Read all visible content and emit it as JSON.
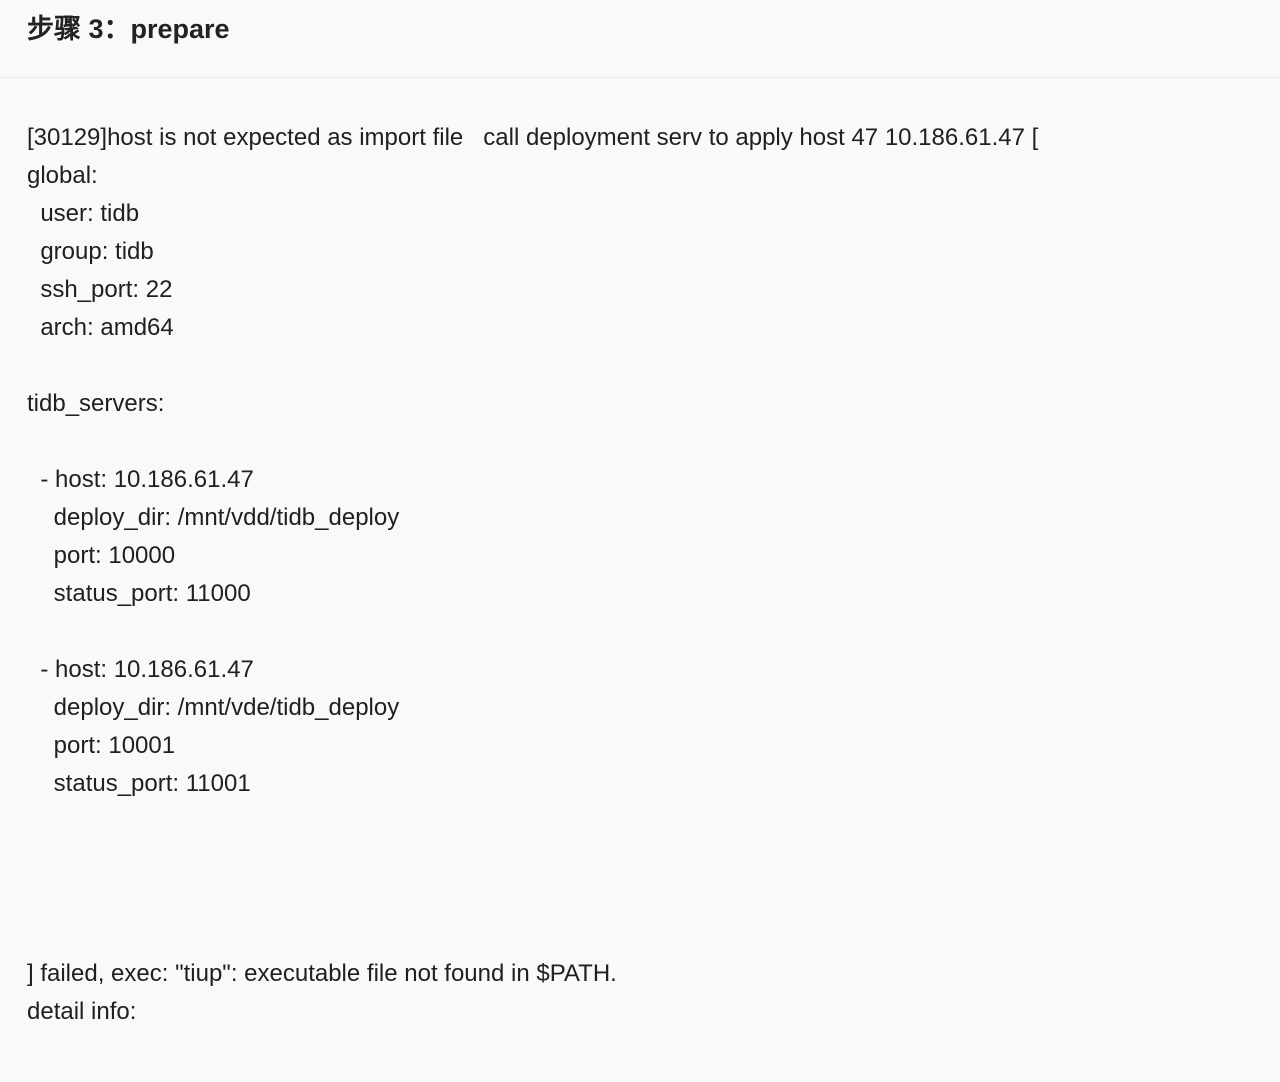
{
  "header": {
    "title": "步骤 3：prepare"
  },
  "log": {
    "lines": [
      "[30129]host is not expected as import file   call deployment serv to apply host 47 10.186.61.47 [",
      "global:",
      "  user: tidb",
      "  group: tidb",
      "  ssh_port: 22",
      "  arch: amd64",
      "",
      "tidb_servers:",
      "",
      "  - host: 10.186.61.47",
      "    deploy_dir: /mnt/vdd/tidb_deploy",
      "    port: 10000",
      "    status_port: 11000",
      "",
      "  - host: 10.186.61.47",
      "    deploy_dir: /mnt/vde/tidb_deploy",
      "    port: 10001",
      "    status_port: 11001",
      "",
      "",
      "",
      "",
      "] failed, exec: \"tiup\": executable file not found in $PATH.",
      "detail info:"
    ]
  }
}
